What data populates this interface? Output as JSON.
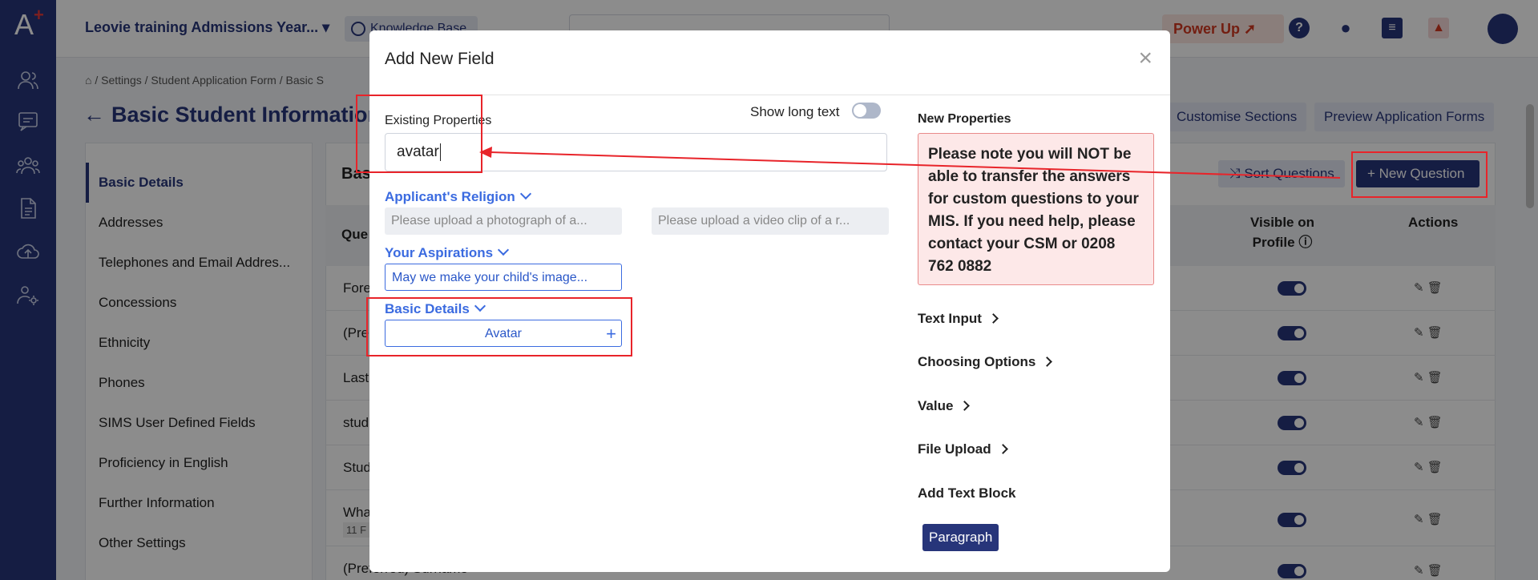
{
  "colors": {
    "brand": "#27357a",
    "link": "#3b6be0",
    "annotation": "#e8242a",
    "warning_bg": "#fde8e8"
  },
  "topbar": {
    "school": "Leovie training Admissions Year...",
    "knowledge_base": "Knowledge Base",
    "power_up": "Power Up",
    "icons": [
      "help-icon",
      "lightbulb-icon",
      "notes-icon",
      "bell-icon",
      "user-avatar-icon"
    ]
  },
  "rail": {
    "icons": [
      "users-icon",
      "chat-icon",
      "group-icon",
      "document-icon",
      "cloud-upload-icon",
      "user-settings-icon"
    ]
  },
  "breadcrumb": [
    "Settings",
    "Student Application Form",
    "Basic S"
  ],
  "page": {
    "title": "Basic Student Information",
    "customise_sections": "Customise Sections",
    "preview_forms": "Preview Application Forms",
    "sort_questions": "Sort Questions",
    "new_question": "New Question",
    "section_heading": "Bas",
    "col_question": "Que",
    "col_visible_line1": "Visible on",
    "col_visible_line2": "Profile",
    "col_actions": "Actions"
  },
  "sidemenu": [
    "Basic Details",
    "Addresses",
    "Telephones and Email Addres...",
    "Concessions",
    "Ethnicity",
    "Phones",
    "SIMS User Defined Fields",
    "Proficiency in English",
    "Further Information",
    "Other Settings"
  ],
  "rows": [
    "Fore",
    "(Pre",
    "Last",
    "stud",
    "Stud",
    "Wha",
    "(Preferred) Surname"
  ],
  "row_badge": "11 F",
  "modal": {
    "title": "Add New Field",
    "close": "×",
    "existing_label": "Existing Properties",
    "show_long_text": "Show long text",
    "search_value": "avatar",
    "groups": [
      {
        "name": "Applicant's Religion",
        "items": [
          "Please upload a photograph of a...",
          "Please upload a video clip of a r..."
        ]
      },
      {
        "name": "Your Aspirations",
        "items": [
          "May we make your child's image..."
        ]
      },
      {
        "name": "Basic Details",
        "items": [
          "Avatar"
        ]
      }
    ],
    "add_symbol": "+",
    "new_properties_label": "New Properties",
    "warning": "Please note you will NOT be able to transfer the answers for custom questions to your MIS. If you need help, please contact your CSM or 0208 762 0882",
    "categories": [
      "Text Input",
      "Choosing Options",
      "Value",
      "File Upload"
    ],
    "add_text_block": "Add Text Block",
    "paragraph_button": "Paragraph"
  }
}
